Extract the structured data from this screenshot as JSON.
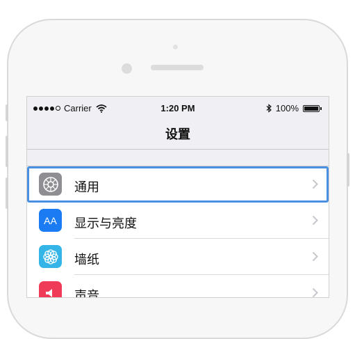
{
  "status_bar": {
    "carrier": "Carrier",
    "time": "1:20 PM",
    "battery": "100%"
  },
  "nav": {
    "title": "设置"
  },
  "settings": [
    {
      "label": "通用",
      "icon": "gear-icon",
      "color": "#8e8e93",
      "selected": true
    },
    {
      "label": "显示与亮度",
      "icon": "text-size-icon",
      "icon_text": "AA",
      "color": "#1a7bf2"
    },
    {
      "label": "墙纸",
      "icon": "flower-icon",
      "color": "#35b4e8"
    },
    {
      "label": "声音",
      "icon": "speaker-icon",
      "color": "#f03b58"
    }
  ],
  "colors": {
    "selection_outline": "#4a90e2",
    "background": "#efeff4"
  }
}
